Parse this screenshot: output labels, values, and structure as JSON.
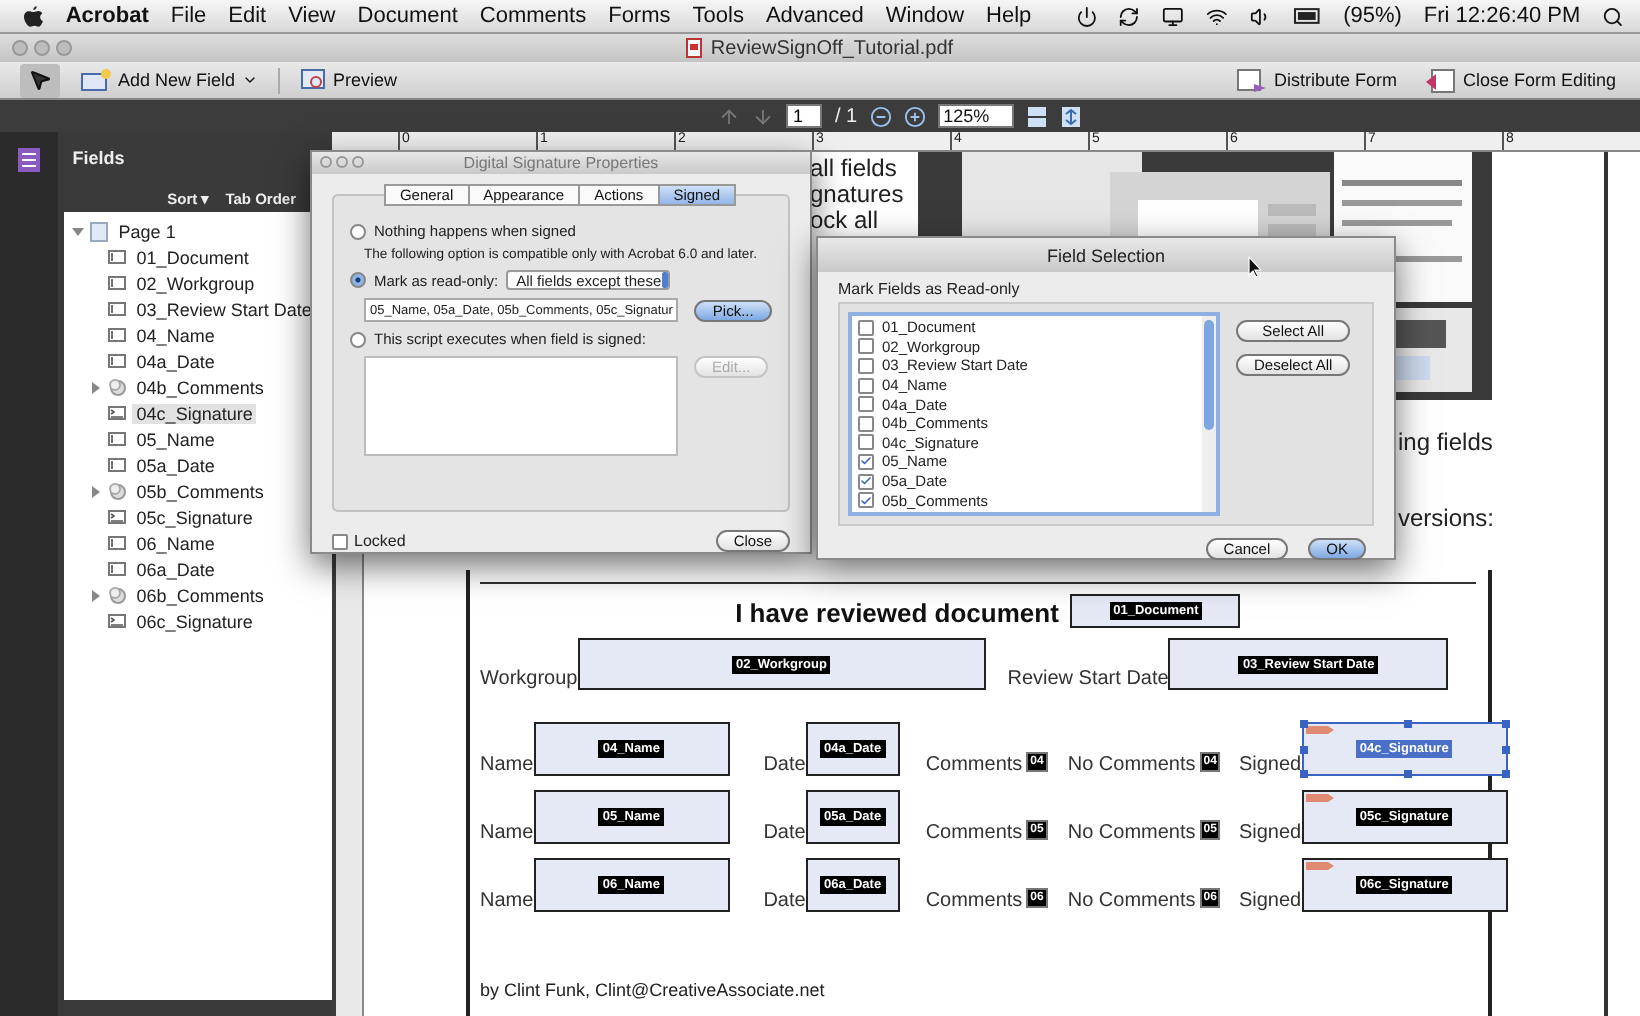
{
  "menu_bar": {
    "app": "Acrobat",
    "items": [
      "File",
      "Edit",
      "View",
      "Document",
      "Comments",
      "Forms",
      "Tools",
      "Advanced",
      "Window",
      "Help"
    ],
    "battery": "(95%)",
    "clock": "Fri 12:26:40 PM"
  },
  "window": {
    "title": "ReviewSignOff_Tutorial.pdf"
  },
  "toolbar": {
    "add_field": "Add New Field",
    "preview": "Preview",
    "distribute": "Distribute Form",
    "close_editing": "Close Form Editing"
  },
  "navigation": {
    "page": "1",
    "page_total": "/ 1",
    "zoom": "125%"
  },
  "fields_panel": {
    "title": "Fields",
    "sort": "Sort ▾",
    "tab_order": "Tab Order",
    "tree": [
      {
        "label": "Page 1",
        "kind": "page",
        "expanded": true,
        "selected": false,
        "children": [
          {
            "label": "01_Document",
            "kind": "text",
            "selected": false
          },
          {
            "label": "02_Workgroup",
            "kind": "text",
            "selected": false
          },
          {
            "label": "03_Review Start Date",
            "kind": "text",
            "selected": false
          },
          {
            "label": "04_Name",
            "kind": "text",
            "selected": false
          },
          {
            "label": "04a_Date",
            "kind": "text",
            "selected": false
          },
          {
            "label": "04b_Comments",
            "kind": "group",
            "expanded": false,
            "selected": false
          },
          {
            "label": "04c_Signature",
            "kind": "signature",
            "selected": true
          },
          {
            "label": "05_Name",
            "kind": "text",
            "selected": false
          },
          {
            "label": "05a_Date",
            "kind": "text",
            "selected": false
          },
          {
            "label": "05b_Comments",
            "kind": "group",
            "expanded": false,
            "selected": false
          },
          {
            "label": "05c_Signature",
            "kind": "signature",
            "selected": false
          },
          {
            "label": "06_Name",
            "kind": "text",
            "selected": false
          },
          {
            "label": "06a_Date",
            "kind": "text",
            "selected": false
          },
          {
            "label": "06b_Comments",
            "kind": "group",
            "expanded": false,
            "selected": false
          },
          {
            "label": "06c_Signature",
            "kind": "signature",
            "selected": false
          }
        ]
      }
    ]
  },
  "ruler": [
    "0",
    "1",
    "2",
    "3",
    "4",
    "5",
    "6",
    "7",
    "8"
  ],
  "document": {
    "lines_left": [
      "all fields",
      "gnatures",
      "ock all"
    ],
    "lines_right": [
      "ing fields",
      "versions:"
    ],
    "embedded": {
      "kind": "picture"
    },
    "form": {
      "heading": "I have reviewed document",
      "document_field": "01_Document",
      "workgroup_label": "Workgroup",
      "workgroup_field": "02_Workgroup",
      "start_label": "Review Start Date",
      "start_field": "03_Review Start Date",
      "rows": [
        {
          "name_label": "Name",
          "name_field": "04_Name",
          "date_label": "Date",
          "date_field": "04a_Date",
          "comments_label": "Comments",
          "comments_tag": "04",
          "no_comments_label": "No Comments",
          "no_comments_tag": "04",
          "signed_label": "Signed",
          "signature_field": "04c_Signature",
          "selected": true
        },
        {
          "name_label": "Name",
          "name_field": "05_Name",
          "date_label": "Date",
          "date_field": "05a_Date",
          "comments_label": "Comments",
          "comments_tag": "05",
          "no_comments_label": "No Comments",
          "no_comments_tag": "05",
          "signed_label": "Signed",
          "signature_field": "05c_Signature",
          "selected": false
        },
        {
          "name_label": "Name",
          "name_field": "06_Name",
          "date_label": "Date",
          "date_field": "06a_Date",
          "comments_label": "Comments",
          "comments_tag": "06",
          "no_comments_label": "No Comments",
          "no_comments_tag": "06",
          "signed_label": "Signed",
          "signature_field": "06c_Signature",
          "selected": false
        }
      ],
      "footer": "by Clint Funk, Clint@CreativeAssociate.net"
    }
  },
  "signature_dialog": {
    "title": "Digital Signature Properties",
    "tabs": [
      {
        "label": "General",
        "selected": false
      },
      {
        "label": "Appearance",
        "selected": false
      },
      {
        "label": "Actions",
        "selected": false
      },
      {
        "label": "Signed",
        "selected": true
      }
    ],
    "option_none": {
      "label": "Nothing happens when signed",
      "selected": false
    },
    "note": "The following option is compatible only with Acrobat 6.0 and later.",
    "option_read_only": {
      "label": "Mark as read-only:",
      "selected": true,
      "mode": "All fields except these",
      "fields": "05_Name, 05a_Date, 05b_Comments, 05c_Signatur",
      "pick": "Pick..."
    },
    "option_script": {
      "label": "This script executes when field is signed:",
      "selected": false,
      "edit": "Edit...",
      "edit_disabled": true
    },
    "locked": {
      "label": "Locked",
      "checked": false
    },
    "close": "Close"
  },
  "field_selection": {
    "title": "Field Selection",
    "group": "Mark Fields as Read-only",
    "items": [
      {
        "label": "01_Document",
        "checked": false
      },
      {
        "label": "02_Workgroup",
        "checked": false
      },
      {
        "label": "03_Review Start Date",
        "checked": false
      },
      {
        "label": "04_Name",
        "checked": false
      },
      {
        "label": "04a_Date",
        "checked": false
      },
      {
        "label": "04b_Comments",
        "checked": false
      },
      {
        "label": "04c_Signature",
        "checked": false
      },
      {
        "label": "05_Name",
        "checked": true
      },
      {
        "label": "05a_Date",
        "checked": true
      },
      {
        "label": "05b_Comments",
        "checked": true
      }
    ],
    "select_all": "Select All",
    "deselect_all": "Deselect All",
    "cancel": "Cancel",
    "ok": "OK"
  }
}
